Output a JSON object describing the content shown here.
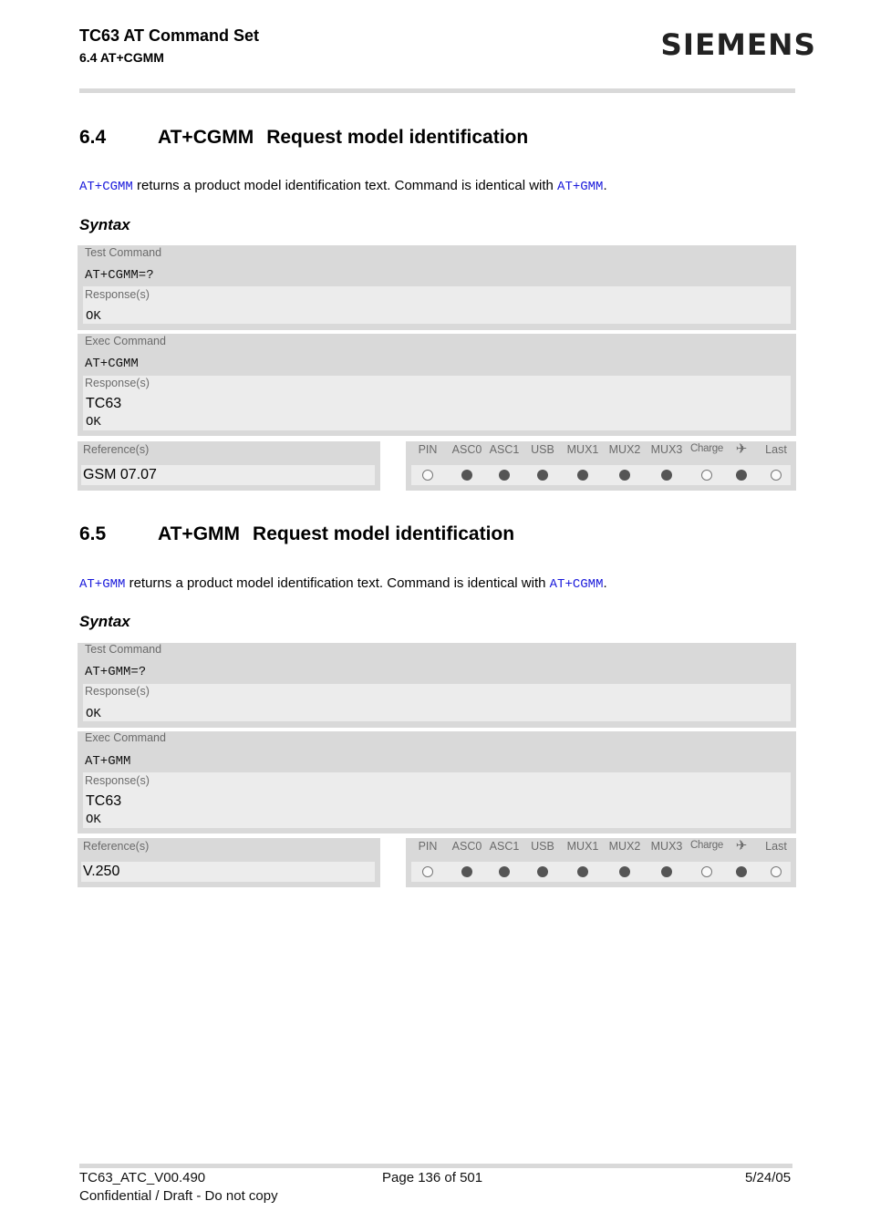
{
  "header": {
    "title": "TC63 AT Command Set",
    "subtitle": "6.4 AT+CGMM",
    "logo": "SIEMENS"
  },
  "sections": [
    {
      "number": "6.4",
      "command": "AT+CGMM",
      "title": "Request model identification",
      "intro": {
        "link1": "AT+CGMM",
        "text": " returns a product model identification text. Command is identical with ",
        "link2": "AT+GMM",
        "end": "."
      },
      "syntax_label": "Syntax",
      "test": {
        "label": "Test Command",
        "command": "AT+CGMM=?",
        "response_label": "Response(s)",
        "response": "OK"
      },
      "exec": {
        "label": "Exec Command",
        "command": "AT+CGMM",
        "response_label": "Response(s)",
        "response_value": "TC63",
        "response": "OK"
      },
      "reference": {
        "label": "Reference(s)",
        "value": "GSM 07.07"
      },
      "flags": [
        {
          "label": "PIN",
          "on": false
        },
        {
          "label": "ASC0",
          "on": true
        },
        {
          "label": "ASC1",
          "on": true
        },
        {
          "label": "USB",
          "on": true
        },
        {
          "label": "MUX1",
          "on": true
        },
        {
          "label": "MUX2",
          "on": true
        },
        {
          "label": "MUX3",
          "on": true
        },
        {
          "label": "Charge",
          "on": false
        },
        {
          "label": "✈",
          "on": true
        },
        {
          "label": "Last",
          "on": false
        }
      ]
    },
    {
      "number": "6.5",
      "command": "AT+GMM",
      "title": "Request model identification",
      "intro": {
        "link1": "AT+GMM",
        "text": " returns a product model identification text. Command is identical with ",
        "link2": "AT+CGMM",
        "end": "."
      },
      "syntax_label": "Syntax",
      "test": {
        "label": "Test Command",
        "command": "AT+GMM=?",
        "response_label": "Response(s)",
        "response": "OK"
      },
      "exec": {
        "label": "Exec Command",
        "command": "AT+GMM",
        "response_label": "Response(s)",
        "response_value": "TC63",
        "response": "OK"
      },
      "reference": {
        "label": "Reference(s)",
        "value": "V.250"
      },
      "flags": [
        {
          "label": "PIN",
          "on": false
        },
        {
          "label": "ASC0",
          "on": true
        },
        {
          "label": "ASC1",
          "on": true
        },
        {
          "label": "USB",
          "on": true
        },
        {
          "label": "MUX1",
          "on": true
        },
        {
          "label": "MUX2",
          "on": true
        },
        {
          "label": "MUX3",
          "on": true
        },
        {
          "label": "Charge",
          "on": false
        },
        {
          "label": "✈",
          "on": true
        },
        {
          "label": "Last",
          "on": false
        }
      ]
    }
  ],
  "footer": {
    "doc_id": "TC63_ATC_V00.490",
    "page": "Page 136 of 501",
    "date": "5/24/05",
    "notice": "Confidential / Draft - Do not copy"
  },
  "colors": {
    "link": "#1a1adb",
    "panel": "#d9d9d9",
    "panel_inner": "#ececec",
    "dot_on": "#555555"
  }
}
